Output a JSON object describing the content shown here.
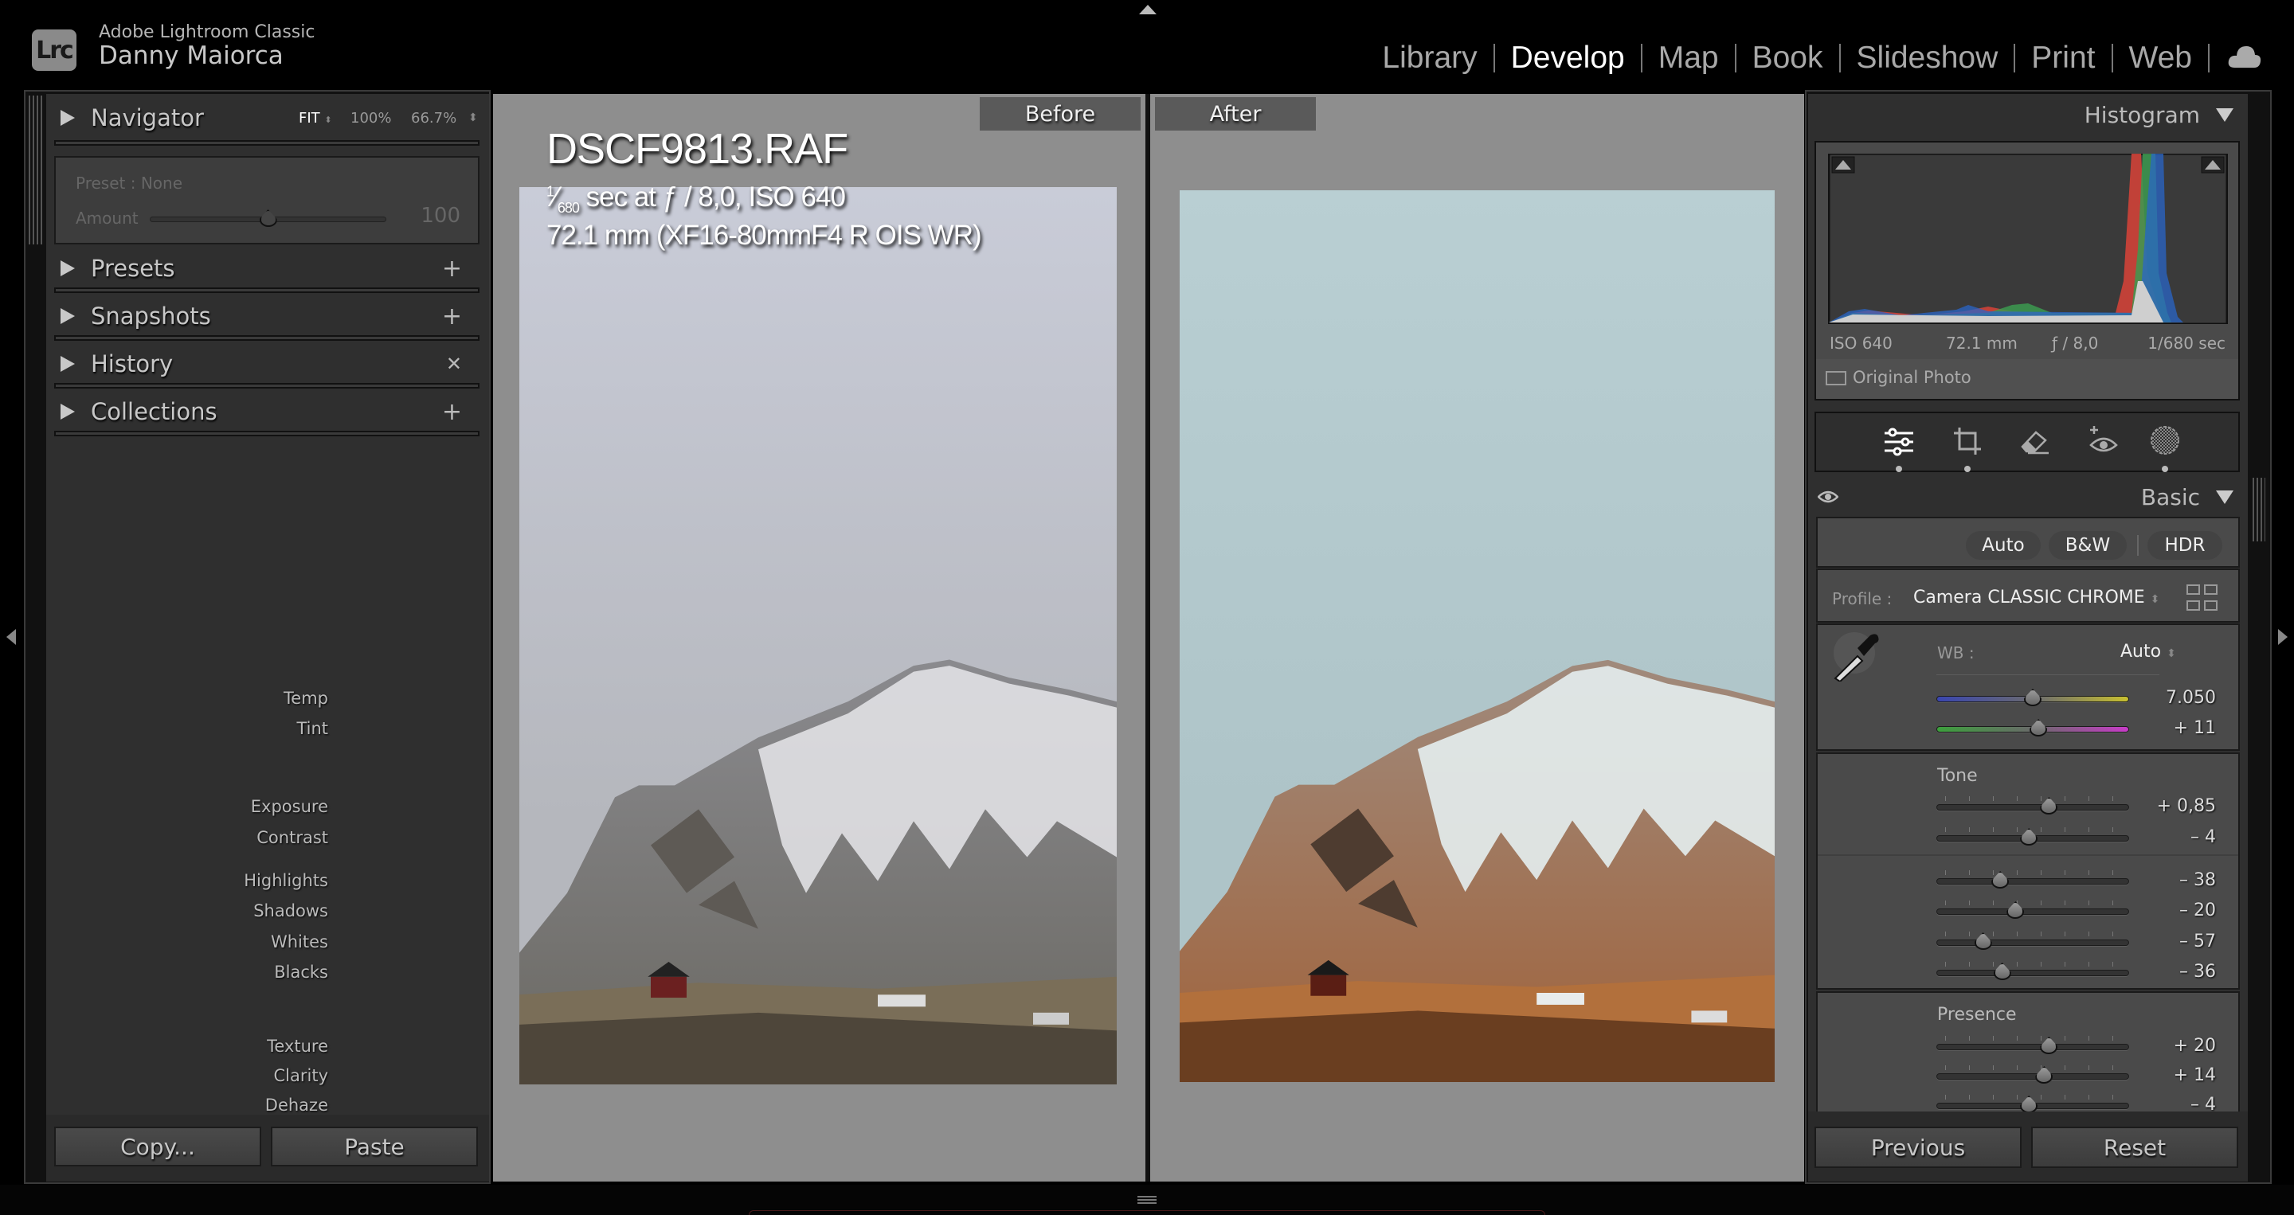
{
  "app": {
    "name": "Adobe Lightroom Classic",
    "user": "Danny Maiorca",
    "logo_text": "Lrc"
  },
  "modules": [
    {
      "label": "Library",
      "active": false
    },
    {
      "label": "Develop",
      "active": true
    },
    {
      "label": "Map",
      "active": false
    },
    {
      "label": "Book",
      "active": false
    },
    {
      "label": "Slideshow",
      "active": false
    },
    {
      "label": "Print",
      "active": false
    },
    {
      "label": "Web",
      "active": false
    }
  ],
  "left_panel": {
    "navigator": {
      "title": "Navigator",
      "zoom_options": [
        "FIT",
        "100%",
        "66.7%"
      ]
    },
    "preset": {
      "label": "Preset : None",
      "amount_label": "Amount",
      "amount_value": "100",
      "amount_level": 0.5
    },
    "sections": [
      {
        "title": "Presets",
        "action": "+"
      },
      {
        "title": "Snapshots",
        "action": "+"
      },
      {
        "title": "History",
        "action": "✕"
      },
      {
        "title": "Collections",
        "action": "+"
      }
    ],
    "copy_label": "Copy...",
    "paste_label": "Paste"
  },
  "center": {
    "before_label": "Before",
    "after_label": "After",
    "filename": "DSCF9813.RAF",
    "shutter_num": "1",
    "shutter_den": "680",
    "exposure_rest": " sec at ƒ / 8,0, ISO 640",
    "lens": "72.1 mm (XF16-80mmF4 R OIS WR)"
  },
  "histogram": {
    "title": "Histogram",
    "iso": "ISO 640",
    "focal": "72.1 mm",
    "aperture": "ƒ / 8,0",
    "shutter": "1/680 sec",
    "original_photo_label": "Original Photo",
    "original_photo_checked": false
  },
  "tools": [
    "edit-sliders",
    "crop",
    "healing-eraser",
    "red-eye",
    "masking"
  ],
  "basic": {
    "title": "Basic",
    "buttons": [
      "Auto",
      "B&W",
      "HDR"
    ],
    "profile_label": "Profile :",
    "profile_value": "Camera CLASSIC CHROME",
    "wb_label": "WB :",
    "wb_value": "Auto",
    "tone_title": "Tone",
    "presence_title": "Presence",
    "sliders": [
      {
        "label": "Temp",
        "value": "7.050",
        "level": 0.5,
        "track": "temp"
      },
      {
        "label": "Tint",
        "value": "+ 11",
        "level": 0.53,
        "track": "tint"
      },
      {
        "label": "Exposure",
        "value": "+ 0,85",
        "level": 0.585
      },
      {
        "label": "Contrast",
        "value": "– 4",
        "level": 0.48
      },
      {
        "label": "Highlights",
        "value": "– 38",
        "level": 0.33
      },
      {
        "label": "Shadows",
        "value": "– 20",
        "level": 0.41
      },
      {
        "label": "Whites",
        "value": "– 57",
        "level": 0.24
      },
      {
        "label": "Blacks",
        "value": "– 36",
        "level": 0.34
      },
      {
        "label": "Texture",
        "value": "+ 20",
        "level": 0.585
      },
      {
        "label": "Clarity",
        "value": "+ 14",
        "level": 0.56
      },
      {
        "label": "Dehaze",
        "value": "– 4",
        "level": 0.48
      }
    ]
  },
  "bottom_right": {
    "previous_label": "Previous",
    "reset_label": "Reset"
  },
  "colors": {
    "active_module": "#ffffff",
    "panel": "#2f2f2f",
    "canvas": "#8e8e8e"
  }
}
